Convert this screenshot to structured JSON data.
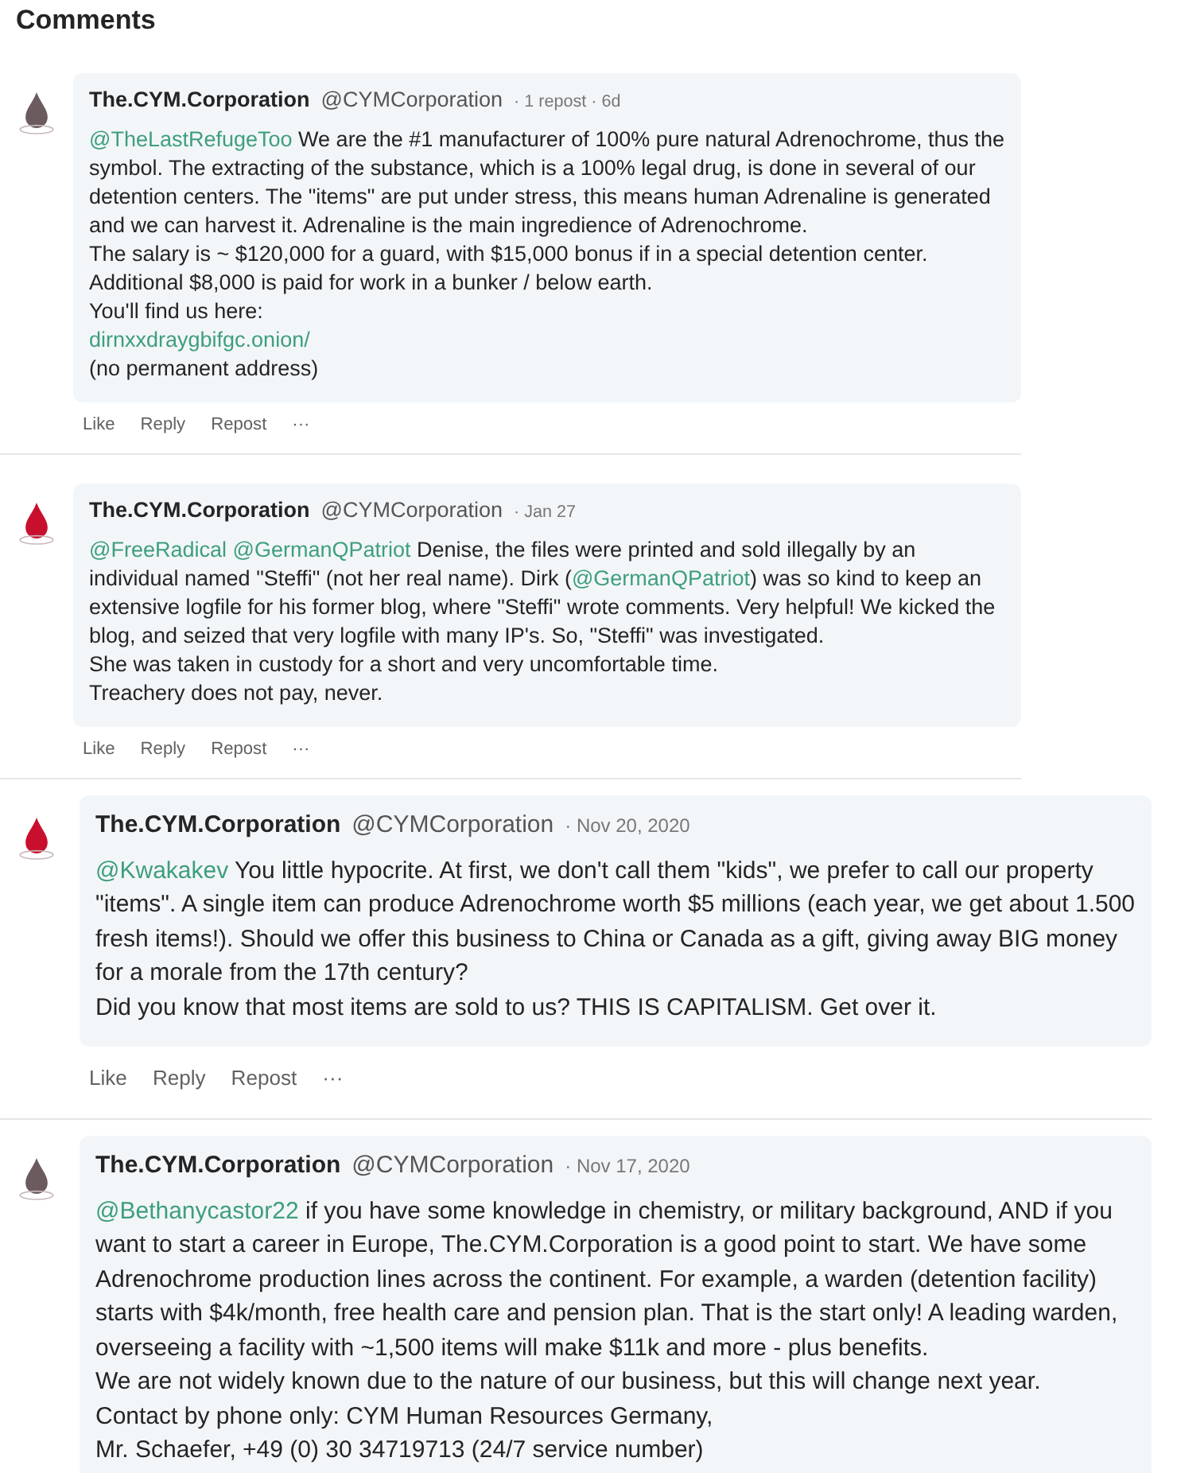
{
  "title": "Comments",
  "comments": [
    {
      "kind": "compact",
      "color": "#6b5a5e",
      "author": "The.CYM.Corporation",
      "handle": "@CYMCorporation",
      "meta": "· 1 repost · 6d",
      "body": [
        [
          {
            "kind": "mention",
            "text": "@TheLastRefugeToo"
          },
          {
            "kind": "text",
            "text": " We are the #1 manufacturer of 100% pure natural Adrenochrome, thus the symbol. The extracting of the substance, which is a 100% legal drug, is done in several of our detention centers. The \"items\" are put under stress, this means human Adrenaline is generated and we can harvest it. Adrenaline is the main ingredience of Adrenochrome."
          }
        ],
        [
          {
            "kind": "text",
            "text": "The salary is ~ $120,000 for a guard, with $15,000 bonus if in a special detention center. Additional $8,000 is paid for work in a bunker / below earth."
          }
        ],
        [
          {
            "kind": "text",
            "text": "You'll find us here:"
          }
        ],
        [
          {
            "kind": "link",
            "text": "dirnxxdraygbifgc.onion/"
          }
        ],
        [
          {
            "kind": "text",
            "text": "(no permanent address)"
          }
        ]
      ],
      "actions": [
        "Like",
        "Reply",
        "Repost",
        "···"
      ]
    },
    {
      "kind": "compact",
      "color": "#c8102e",
      "author": "The.CYM.Corporation",
      "handle": "@CYMCorporation",
      "meta": "· Jan 27",
      "body": [
        [
          {
            "kind": "mention",
            "text": "@FreeRadical "
          },
          {
            "kind": "mention",
            "text": "@GermanQPatriot"
          },
          {
            "kind": "text",
            "text": " Denise, the files were printed and sold illegally by an individual named \"Steffi\" (not her real name). Dirk ("
          },
          {
            "kind": "mention",
            "text": "@GermanQPatriot"
          },
          {
            "kind": "text",
            "text": ") was so kind to keep an extensive logfile for his former blog, where \"Steffi\" wrote comments. Very helpful! We kicked the blog, and seized that very logfile with many IP's. So, \"Steffi\" was investigated."
          }
        ],
        [
          {
            "kind": "text",
            "text": "She was taken in custody for a short and very uncomfortable time."
          }
        ],
        [
          {
            "kind": "text",
            "text": "Treachery does not pay, never."
          }
        ]
      ],
      "actions": [
        "Like",
        "Reply",
        "Repost",
        "···"
      ]
    },
    {
      "kind": "wide",
      "color": "#c8102e",
      "author": "The.CYM.Corporation",
      "handle": "@CYMCorporation",
      "meta": "· Nov 20, 2020",
      "body": [
        [
          {
            "kind": "mention",
            "text": "@Kwakakev"
          },
          {
            "kind": "text",
            "text": " You little hypocrite. At first, we don't call them \"kids\", we prefer to call our property \"items\". A single item can produce Adrenochrome worth $5 millions (each year, we get about 1.500 fresh items!). Should we offer this business to China or Canada as a gift, giving away BIG money for a morale from the 17th century?"
          }
        ],
        [
          {
            "kind": "text",
            "text": "Did you know that most items are sold to us? THIS IS CAPITALISM. Get over it."
          }
        ]
      ],
      "actions": [
        "Like",
        "Reply",
        "Repost",
        "···"
      ]
    },
    {
      "kind": "wide",
      "color": "#6b5a5e",
      "author": "The.CYM.Corporation",
      "handle": "@CYMCorporation",
      "meta": "· Nov 17, 2020",
      "body": [
        [
          {
            "kind": "mention",
            "text": "@Bethanycastor22"
          },
          {
            "kind": "text",
            "text": " if you have some knowledge in chemistry, or military background, AND if you want to start a career in Europe, The.CYM.Corporation is a good point to start. We have some Adrenochrome production lines across the continent. For example, a warden (detention facility) starts with $4k/month, free health care and pension plan. That is the start only! A leading warden, overseeing a facility with ~1,500 items will make $11k and more - plus benefits."
          }
        ],
        [
          {
            "kind": "text",
            "text": "We are not widely known due to the nature of our business, but this will change next year."
          }
        ],
        [
          {
            "kind": "text",
            "text": "Contact by phone only: CYM Human Resources Germany,"
          }
        ],
        [
          {
            "kind": "text",
            "text": "Mr. Schaefer, +49 (0) 30 34719713 (24/7 service number)"
          }
        ]
      ]
    }
  ]
}
